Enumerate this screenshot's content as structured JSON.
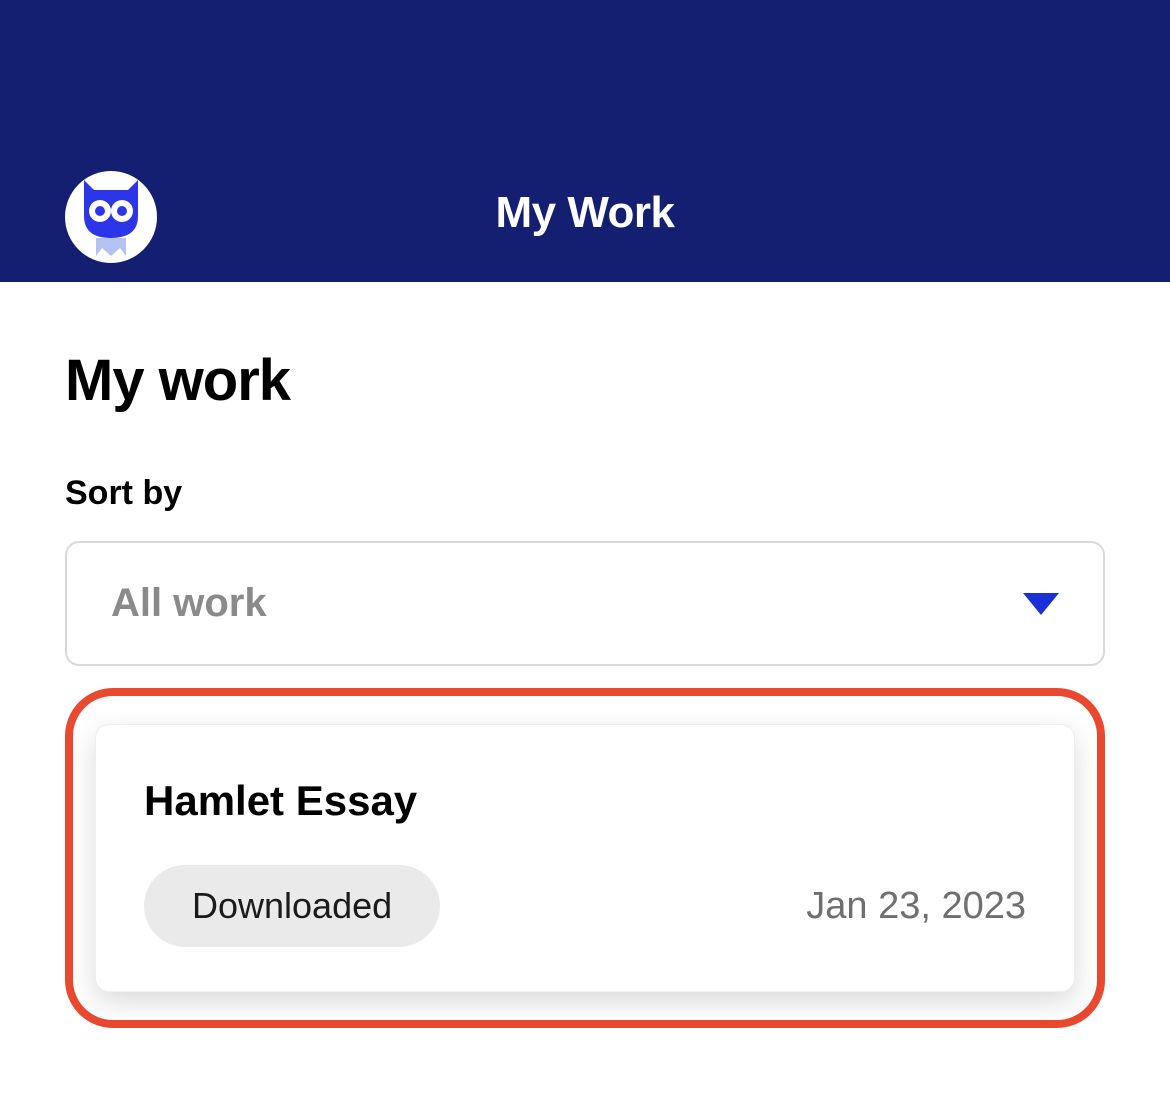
{
  "header": {
    "title": "My Work"
  },
  "page": {
    "title": "My work"
  },
  "sort": {
    "label": "Sort by",
    "selected": "All work"
  },
  "work_item": {
    "title": "Hamlet Essay",
    "status": "Downloaded",
    "date": "Jan 23, 2023"
  }
}
